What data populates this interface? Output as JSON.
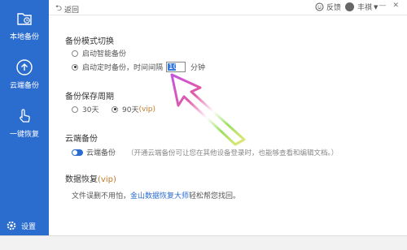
{
  "sidebar": {
    "items": [
      {
        "label": "本地备份"
      },
      {
        "label": "云端备份"
      },
      {
        "label": "一键恢复"
      }
    ],
    "settings_label": "设置"
  },
  "topbar": {
    "back_label": "返回",
    "feedback_label": "反馈",
    "user_name": "丰祺",
    "window_controls": [
      "—",
      "✕"
    ]
  },
  "backup_mode": {
    "title": "备份模式切换",
    "option_smart": "启动智能备份",
    "option_timed_prefix": "启动定时备份，时间间隔",
    "interval_value": "10",
    "interval_unit": "分钟",
    "selected": "timed"
  },
  "retention": {
    "title": "备份保存周期",
    "option_30": "30天",
    "option_90": "90天",
    "option_90_vip": "(vip)",
    "selected": "90"
  },
  "cloud_backup": {
    "title": "云端备份",
    "toggle_label": "云端备份",
    "toggle_on": true,
    "hint": "（开通云端备份可让您在其他设备登录时，也能够查看和编辑文档。）"
  },
  "recovery": {
    "title": "数据恢复",
    "title_vip": "(vip)",
    "text_before": "文件误删不用怕，",
    "link_text": "金山数据恢复大师",
    "text_after": "轻松帮您找回。"
  },
  "colors": {
    "sidebar_bg": "#2b6ccf",
    "accent": "#2b6ccf",
    "vip": "#c0792b"
  }
}
